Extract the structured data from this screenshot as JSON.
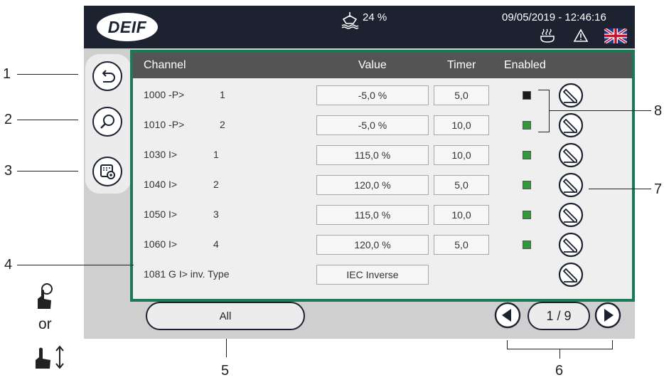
{
  "header": {
    "logo_text": "DEIF",
    "fuel_value": "24 %",
    "datetime": "09/05/2019 - 12:46:16",
    "icons": [
      "fuel-level-icon",
      "heater-icon",
      "warning-icon",
      "uk-flag-icon"
    ]
  },
  "sidebar": {
    "buttons": [
      {
        "name": "back-button",
        "icon": "back-arrow-icon"
      },
      {
        "name": "search-button",
        "icon": "magnifier-icon"
      },
      {
        "name": "settings-button",
        "icon": "settings-gear-icon"
      }
    ]
  },
  "table": {
    "headers": {
      "channel": "Channel",
      "value": "Value",
      "timer": "Timer",
      "enabled": "Enabled"
    },
    "rows": [
      {
        "channel": "1000 -P>",
        "index": "1",
        "value": "-5,0 %",
        "timer": "5,0",
        "enabled": false
      },
      {
        "channel": "1010 -P>",
        "index": "2",
        "value": "-5,0 %",
        "timer": "10,0",
        "enabled": true
      },
      {
        "channel": "1030 I>",
        "index": "1",
        "value": "115,0 %",
        "timer": "10,0",
        "enabled": true
      },
      {
        "channel": "1040 I>",
        "index": "2",
        "value": "120,0 %",
        "timer": "5,0",
        "enabled": true
      },
      {
        "channel": "1050 I>",
        "index": "3",
        "value": "115,0 %",
        "timer": "10,0",
        "enabled": true
      },
      {
        "channel": "1060 I>",
        "index": "4",
        "value": "120,0 %",
        "timer": "5,0",
        "enabled": true
      },
      {
        "channel": "1081 G I> inv. Type",
        "index": "",
        "value": "IEC Inverse",
        "timer": "",
        "enabled": null
      }
    ]
  },
  "footer": {
    "filter_label": "All",
    "page": "1 / 9"
  },
  "callouts": {
    "labels": [
      "1",
      "2",
      "3",
      "4",
      "5",
      "6",
      "7",
      "8"
    ],
    "or_text": "or"
  },
  "colors": {
    "topbar": "#1d2230",
    "panel_border": "#1a7a55",
    "enabled_on": "#2e9a3a",
    "enabled_off": "#1a1a1a",
    "table_header": "#545454"
  }
}
